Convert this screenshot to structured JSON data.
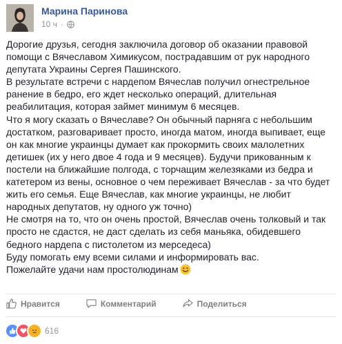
{
  "post": {
    "author": "Марина Паринова",
    "timestamp": "10 ч",
    "separator": "·",
    "lines": [
      "Дорогие друзья, сегодня заключила договор об оказании правовой",
      "помощи с Вячеславом Химикусом, пострадавшим от рук народного",
      "депутата Украины Сергея Пашинского.",
      "В результате встречи с нардепом Вячеслав получил огнестрельное",
      "ранение в бедро, его ждет несколько операций, длительная",
      "реабилитация, которая займет минимум 6 месяцев.",
      "Что я могу сказать о Вячеславе? Он обычный парняга с небольшим",
      "достатком, разговаривает просто, иногда матом, иногда выпивает, еще",
      "он как многие украинцы думает как прокормить своих малолетних",
      "детишек (их у него двое 4 года и 9 месяцев). Будучи прикованным к",
      "постели на ближайшие полгода, с торчащим железяками из бедра и",
      "катетером из вены, основное о чем переживает Вячеслав - за что будет",
      "жить его семья. Еще Вячеслав, как многие украинцы, не любит",
      "народных депутатов, ну одного уж точно)",
      "Не смотря на то, что он очень простой, Вячеслав очень толковый и так",
      "просто не сдастся, не даст сделать из себя маньяка, обидевшего",
      "бедного нардепа с пистолетом из мерседеса)",
      "Буду помогать ему всеми силами и информировать вас.",
      "Пожелайте удачи нам простолюдинам"
    ]
  },
  "actions": {
    "like": "Нравится",
    "comment": "Комментарий",
    "share": "Поделиться"
  },
  "reactions": {
    "icons": [
      "like-icon",
      "love-icon",
      "sad-icon"
    ],
    "colors": {
      "like": "#5890ff",
      "love": "#f25268",
      "sad": "#f7b125"
    },
    "count": "616"
  },
  "icons": {
    "audience": "globe-icon",
    "emoji": "smile-emoji"
  }
}
